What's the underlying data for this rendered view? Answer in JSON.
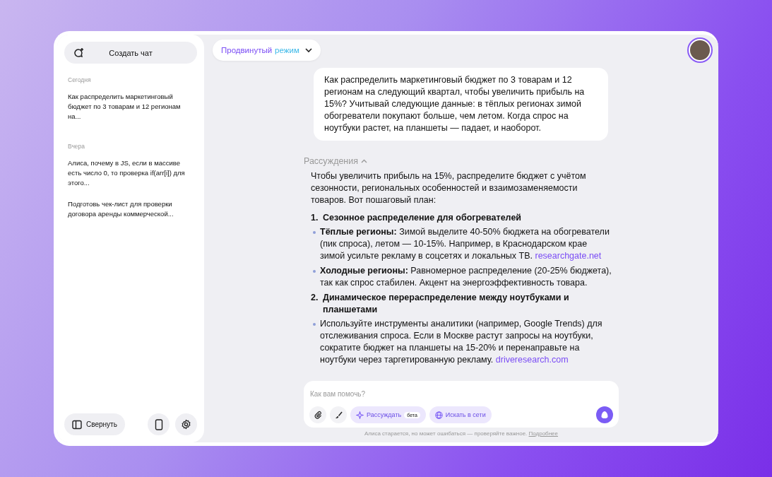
{
  "sidebar": {
    "new_chat": "Создать чат",
    "groups": [
      {
        "label": "Сегодня",
        "chats": [
          {
            "title": "Как распределить маркетинговый бюджет по 3 товарам и 12 регионам на...",
            "selected": false
          }
        ]
      },
      {
        "label": "Вчера",
        "chats": [
          {
            "title": "Алиса, почему в JS, если в массиве есть число 0, то проверка if(arr[i]) для этого...",
            "selected": false
          },
          {
            "title": "Подготовь чек-лист для проверки договора аренды коммерческой...",
            "selected": false
          }
        ]
      }
    ],
    "collapse": "Свернуть"
  },
  "mode_selector": {
    "label_part_1": "Продвинутый",
    "label_part_2": "режим"
  },
  "user_message": "Как распределить маркетинговый бюджет по 3 товарам и 12 регионам на следующий квартал, чтобы увеличить прибыль на 15%? Учитывай следующие данные: в тёплых регионах зимой обогреватели покупают больше, чем летом. Когда спрос на ноутбуки растет, на планшеты — падает, и наоборот.",
  "reasoning_toggle": {
    "label": "Рассуждения",
    "expanded": true
  },
  "answer": {
    "intro": "Чтобы увеличить прибыль на 15%, распределите бюджет с учётом сезонности, региональных особенностей и взаимозаменяемости товаров. Вот пошаговый план:",
    "steps": [
      {
        "number": "1.",
        "title": "Сезонное распределение для обогревателей",
        "bullets": [
          {
            "text": "**Тёплые регионы:** Зимой выделите 40-50% бюджета на обогреватели (пик спроса), летом — 10-15%. Например, в Краснодарском крае зимой усильте рекламу в соцсетях и локальных ТВ.",
            "link": "researchgate.net"
          },
          {
            "text": "**Холодные регионы:** Равномерное распределение (20-25% бюджета), так как спрос стабилен. Акцент на энергоэффективность товара."
          }
        ]
      },
      {
        "number": "2.",
        "title": "Динамическое перераспределение между ноутбуками и планшетами",
        "bullets": [
          {
            "text": "Используйте инструменты аналитики (например, Google Trends) для отслеживания спроса. Если в Москве растут запросы на ноутбуки, сократите бюджет на планшеты на 15-20% и перенаправьте на ноутбуки через таргетированную рекламу.",
            "link": "driveresearch.com"
          }
        ]
      }
    ]
  },
  "composer": {
    "placeholder": "Как вам помочь?",
    "think_button": "Рассуждать",
    "think_badge": "бета",
    "search_button": "Искать в сети"
  },
  "disclaimer": {
    "text": "Алиса старается, но может ошибаться — проверяйте важное.",
    "link": "Подробнее"
  }
}
